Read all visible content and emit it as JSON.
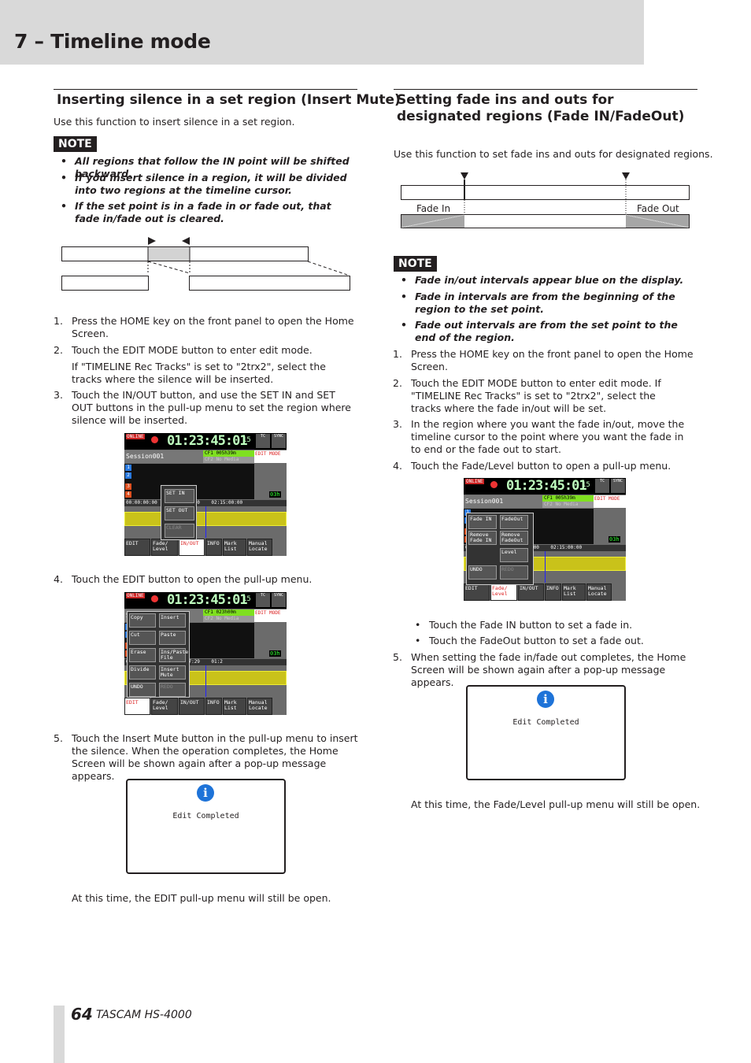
{
  "header": {
    "title": "7 – Timeline mode"
  },
  "left": {
    "heading": "Inserting silence in a set region (Insert Mute)",
    "intro": "Use this function to insert silence in a set region.",
    "note_label": "NOTE",
    "notes": [
      "All regions that follow the IN point will be shifted backward.",
      "If you insert silence in a region, it will be divided into two regions at the timeline cursor.",
      "If the set point is in a fade in or fade out, that fade in/fade out is cleared."
    ],
    "steps": [
      {
        "n": "1.",
        "text": "Press the HOME key on the front panel to open the Home Screen."
      },
      {
        "n": "2.",
        "text": "Touch the EDIT MODE button to enter edit mode.",
        "sub": "If \"TIMELINE Rec Tracks\" is set to \"2trx2\", select the tracks where the silence will be inserted."
      },
      {
        "n": "3.",
        "text": "Touch the IN/OUT button, and use the SET IN and SET OUT buttons in the pull-up menu to set the region where silence will be inserted."
      },
      {
        "n": "4.",
        "text": "Touch the EDIT button to open the pull-up menu."
      },
      {
        "n": "5.",
        "text": "Touch the Insert Mute button in the pull-up menu to insert the silence. When the operation completes, the Home Screen will be shown again after a pop-up message appears."
      }
    ],
    "dialog_text": "Edit Completed",
    "closing": "At this time, the EDIT pull-up menu will still be open."
  },
  "right": {
    "heading": "Setting fade ins and outs for designated regions (Fade IN/FadeOut)",
    "intro": "Use this function to set fade ins and outs for designated regions.",
    "diagram": {
      "fade_in": "Fade In",
      "fade_out": "Fade Out"
    },
    "note_label": "NOTE",
    "notes": [
      "Fade in/out intervals appear blue on the display.",
      "Fade in intervals are from the beginning of the region to the set point.",
      "Fade out intervals are from the set point to the end of the region."
    ],
    "steps": [
      {
        "n": "1.",
        "text": "Press the HOME key on the front panel to open the Home Screen."
      },
      {
        "n": "2.",
        "text": "Touch the EDIT MODE button to enter edit mode. If \"TIMELINE Rec Tracks\" is set to \"2trx2\", select the tracks where the fade in/out will be set."
      },
      {
        "n": "3.",
        "text": "In the region where you want the fade in/out, move the timeline cursor to the point where you want the fade in to end or the fade out to start."
      },
      {
        "n": "4.",
        "text": "Touch the Fade/Level button to open a pull-up menu."
      },
      {
        "n": "5.",
        "text": "When setting the fade in/fade out completes, the Home Screen will be shown again after a pop-up message appears."
      }
    ],
    "sub_bullets": [
      "Touch the Fade IN button to set a fade in.",
      "Touch the FadeOut button to set a fade out."
    ],
    "dialog_text": "Edit Completed",
    "closing": "At this time, the Fade/Level pull-up menu will still be open."
  },
  "screens": [
    {
      "online": "ONLINE",
      "time": "01:23:45:01",
      "fps": "15",
      "tc": "TC",
      "sync": "SYNC",
      "session": "Session001",
      "cf1": "CF1 005h39m",
      "cf2": "CF2 No Media",
      "mode": "EDIT MODE",
      "timecodes": [
        "00:00:00:00",
        "01:30:00:00",
        "02:15:00:00"
      ],
      "zoom": "03h",
      "popup": [
        "SET IN",
        "SET OUT",
        "CLEAR"
      ],
      "buttons": [
        "EDIT",
        "Fade/ Level",
        "IN/OUT",
        "INFO",
        "Mark List",
        "Manual Locate"
      ],
      "active": 2
    },
    {
      "online": "ONLINE",
      "time": "01:23:45:01",
      "fps": "15",
      "tc": "TC",
      "sync": "SYNC",
      "session": "Session001",
      "cf1": "CF1 023h00m",
      "cf2": "CF2 No Media",
      "mode": "EDIT MODE",
      "timecodes": [
        "01:23:44:29",
        "01:23:47:29",
        "01:2"
      ],
      "zoom": "03h",
      "popup": [
        "Copy",
        "Insert",
        "Cut",
        "Paste",
        "Erase",
        "Ins/Paste File",
        "Divide",
        "Insert Mute",
        "UNDO",
        "REDO"
      ],
      "buttons": [
        "EDIT",
        "Fade/ Level",
        "IN/OUT",
        "INFO",
        "Mark List",
        "Manual Locate"
      ],
      "active": 0
    },
    {
      "online": "ONLINE",
      "time": "01:23:45:01",
      "fps": "15",
      "tc": "TC",
      "sync": "SYNC",
      "session": "Session001",
      "cf1": "CF1 005h39m",
      "cf2": "CF2 No Media",
      "mode": "EDIT MODE",
      "timecodes": [
        "00:00:00:00",
        "01:30:00:00",
        "02:15:00:00"
      ],
      "zoom": "03h",
      "popup": [
        "Fade IN",
        "FadeOut",
        "Remove Fade IN",
        "Remove FadeOut",
        "Level",
        "UNDO",
        "REDO"
      ],
      "buttons": [
        "EDIT",
        "Fade/ Level",
        "IN/OUT",
        "INFO",
        "Mark List",
        "Manual Locate"
      ],
      "active": 1
    }
  ],
  "footer": {
    "page": "64",
    "brand": "TASCAM",
    "model": "HS-4000"
  },
  "colors": {
    "header_bg": "#d9d9d9",
    "note_bg": "#231f20",
    "info_icon": "#1e73d8",
    "screen_accent": "#c9c21a"
  }
}
